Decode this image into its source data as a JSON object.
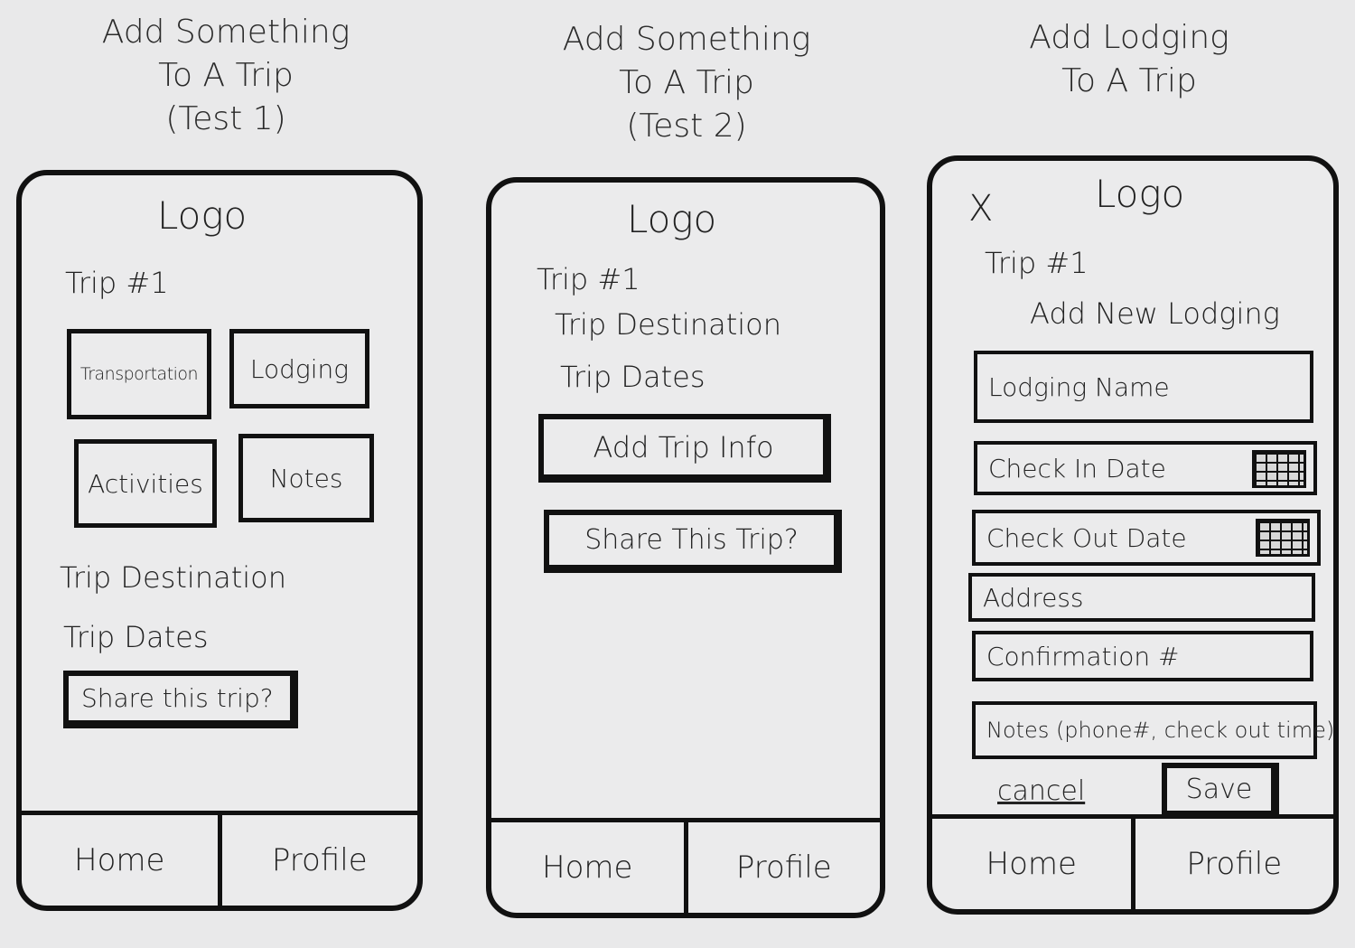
{
  "screens": [
    {
      "title_lines": [
        "Add Something",
        "To A Trip",
        "(Test 1)"
      ],
      "logo": "Logo",
      "trip_name": "Trip #1",
      "tiles": [
        "Transportation",
        "Lodging",
        "Activities",
        "Notes"
      ],
      "destination": "Trip Destination",
      "dates": "Trip Dates",
      "share_button": "Share this trip?",
      "tabs": [
        "Home",
        "Profile"
      ]
    },
    {
      "title_lines": [
        "Add Something",
        "To A Trip",
        "(Test 2)"
      ],
      "logo": "Logo",
      "trip_name": "Trip #1",
      "destination": "Trip Destination",
      "dates": "Trip Dates",
      "add_info_button": "Add Trip Info",
      "share_button": "Share This Trip?",
      "tabs": [
        "Home",
        "Profile"
      ]
    },
    {
      "title_lines": [
        "Add Lodging",
        "To A Trip"
      ],
      "close": "X",
      "logo": "Logo",
      "trip_name": "Trip #1",
      "section_title": "Add New Lodging",
      "fields": {
        "lodging_name": "Lodging Name",
        "check_in": "Check In Date",
        "check_out": "Check Out Date",
        "address": "Address",
        "confirmation": "Confirmation #",
        "notes": "Notes (phone#, check out time)"
      },
      "cancel": "cancel",
      "save": "Save",
      "tabs": [
        "Home",
        "Profile"
      ]
    }
  ]
}
